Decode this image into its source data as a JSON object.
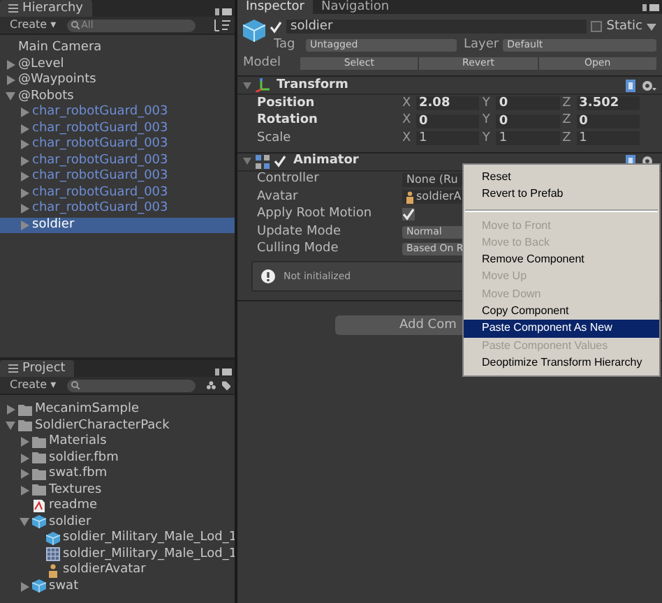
{
  "hierarchy": {
    "tab": "Hierarchy",
    "create": "Create ▾",
    "search_placeholder": "All",
    "items": [
      {
        "label": "Main Camera",
        "expandable": false,
        "prefab": false,
        "selected": false
      },
      {
        "label": "@Level",
        "expandable": true,
        "expanded": false,
        "prefab": false,
        "selected": false
      },
      {
        "label": "@Waypoints",
        "expandable": true,
        "expanded": false,
        "prefab": false,
        "selected": false
      },
      {
        "label": "@Robots",
        "expandable": true,
        "expanded": true,
        "prefab": false,
        "selected": false,
        "children": [
          {
            "label": "char_robotGuard_003",
            "expandable": true,
            "expanded": false,
            "prefab": true,
            "selected": false
          },
          {
            "label": "char_robotGuard_003",
            "expandable": true,
            "expanded": false,
            "prefab": true,
            "selected": false
          },
          {
            "label": "char_robotGuard_003",
            "expandable": true,
            "expanded": false,
            "prefab": true,
            "selected": false
          },
          {
            "label": "char_robotGuard_003",
            "expandable": true,
            "expanded": false,
            "prefab": true,
            "selected": false
          },
          {
            "label": "char_robotGuard_003",
            "expandable": true,
            "expanded": false,
            "prefab": true,
            "selected": false
          },
          {
            "label": "char_robotGuard_003",
            "expandable": true,
            "expanded": false,
            "prefab": true,
            "selected": false
          },
          {
            "label": "char_robotGuard_003",
            "expandable": true,
            "expanded": false,
            "prefab": true,
            "selected": false
          },
          {
            "label": "soldier",
            "expandable": true,
            "expanded": false,
            "prefab": true,
            "selected": true
          }
        ]
      }
    ]
  },
  "project": {
    "tab": "Project",
    "create": "Create ▾",
    "items": [
      {
        "label": "MecanimSample",
        "kind": "folder",
        "expandable": true,
        "expanded": false
      },
      {
        "label": "SoldierCharacterPack",
        "kind": "folder",
        "expandable": true,
        "expanded": true,
        "children": [
          {
            "label": "Materials",
            "kind": "folder",
            "expandable": true,
            "expanded": false
          },
          {
            "label": "soldier.fbm",
            "kind": "folder",
            "expandable": true,
            "expanded": false
          },
          {
            "label": "swat.fbm",
            "kind": "folder",
            "expandable": true,
            "expanded": false
          },
          {
            "label": "Textures",
            "kind": "folder",
            "expandable": true,
            "expanded": false
          },
          {
            "label": "readme",
            "kind": "pdf",
            "expandable": false
          },
          {
            "label": "soldier",
            "kind": "model",
            "expandable": true,
            "expanded": true,
            "children": [
              {
                "label": "soldier_Military_Male_Lod_1",
                "kind": "model",
                "expandable": false
              },
              {
                "label": "soldier_Military_Male_Lod_1",
                "kind": "mesh",
                "expandable": false
              },
              {
                "label": "soldierAvatar",
                "kind": "avatar",
                "expandable": false
              }
            ]
          },
          {
            "label": "swat",
            "kind": "model",
            "expandable": true,
            "expanded": false
          }
        ]
      }
    ]
  },
  "inspector": {
    "tabs": [
      {
        "label": "Inspector",
        "selected": true
      },
      {
        "label": "Navigation",
        "selected": false
      }
    ],
    "object": {
      "name": "soldier",
      "active": true,
      "static_label": "Static",
      "static": false,
      "tag_label": "Tag",
      "tag": "Untagged",
      "layer_label": "Layer",
      "layer": "Default",
      "model_label": "Model",
      "model_buttons": [
        "Select",
        "Revert",
        "Open"
      ]
    },
    "transform": {
      "title": "Transform",
      "expanded": true,
      "rows": [
        {
          "label": "Position",
          "overridden": true,
          "values": [
            {
              "axis": "X",
              "value": "2.08"
            },
            {
              "axis": "Y",
              "value": "0"
            },
            {
              "axis": "Z",
              "value": "3.502"
            }
          ]
        },
        {
          "label": "Rotation",
          "overridden": true,
          "values": [
            {
              "axis": "X",
              "value": "0"
            },
            {
              "axis": "Y",
              "value": "0"
            },
            {
              "axis": "Z",
              "value": "0"
            }
          ]
        },
        {
          "label": "Scale",
          "overridden": false,
          "values": [
            {
              "axis": "X",
              "value": "1"
            },
            {
              "axis": "Y",
              "value": "1"
            },
            {
              "axis": "Z",
              "value": "1"
            }
          ]
        }
      ]
    },
    "animator": {
      "title": "Animator",
      "expanded": true,
      "enabled": true,
      "properties": [
        {
          "label": "Controller",
          "kind": "object",
          "value": "None (Ru"
        },
        {
          "label": "Avatar",
          "kind": "avatar",
          "value": "soldierA"
        },
        {
          "label": "Apply Root Motion",
          "kind": "checkbox",
          "checked": true
        },
        {
          "label": "Update Mode",
          "kind": "dropdown",
          "value": "Normal"
        },
        {
          "label": "Culling Mode",
          "kind": "dropdown",
          "value": "Based On R"
        }
      ],
      "message": "Not initialized"
    },
    "add_component": "Add Com"
  },
  "context_menu": {
    "items": [
      {
        "label": "Reset",
        "disabled": false,
        "selected": false,
        "separator_before": false
      },
      {
        "label": "Revert to Prefab",
        "disabled": false,
        "selected": false,
        "separator_before": false
      },
      {
        "label": "Move to Front",
        "disabled": true,
        "selected": false,
        "separator_before": true
      },
      {
        "label": "Move to Back",
        "disabled": true,
        "selected": false,
        "separator_before": false
      },
      {
        "label": "Remove Component",
        "disabled": false,
        "selected": false,
        "separator_before": false
      },
      {
        "label": "Move Up",
        "disabled": true,
        "selected": false,
        "separator_before": false
      },
      {
        "label": "Move Down",
        "disabled": true,
        "selected": false,
        "separator_before": false
      },
      {
        "label": "Copy Component",
        "disabled": false,
        "selected": false,
        "separator_before": false
      },
      {
        "label": "Paste Component As New",
        "disabled": false,
        "selected": true,
        "separator_before": false
      },
      {
        "label": "Paste Component Values",
        "disabled": true,
        "selected": false,
        "separator_before": false
      },
      {
        "label": "Deoptimize Transform Hierarchy",
        "disabled": false,
        "selected": false,
        "separator_before": false
      }
    ]
  }
}
